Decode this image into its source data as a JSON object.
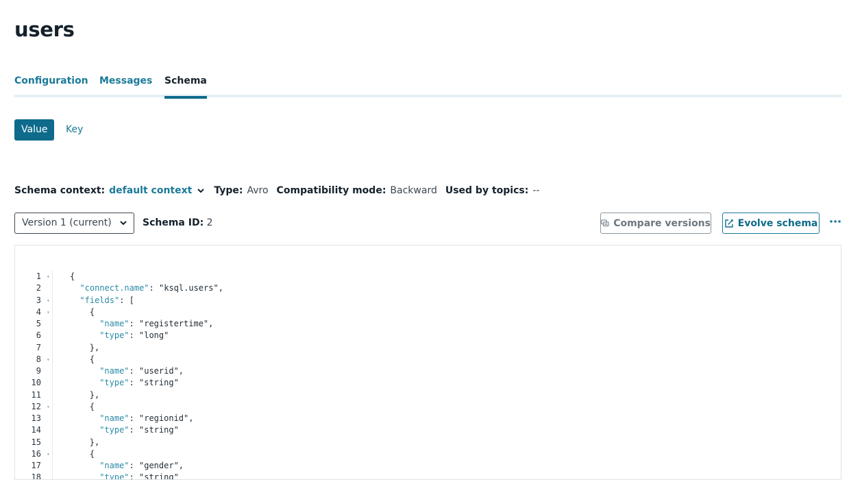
{
  "page": {
    "title": "users"
  },
  "tabs": [
    {
      "label": "Configuration"
    },
    {
      "label": "Messages"
    },
    {
      "label": "Schema"
    }
  ],
  "segment": {
    "value_label": "Value",
    "key_label": "Key"
  },
  "meta": {
    "context_label": "Schema context:",
    "context_value": "default context",
    "type_label": "Type:",
    "type_value": "Avro",
    "compat_label": "Compatibility mode:",
    "compat_value": "Backward",
    "topics_label": "Used by topics:",
    "topics_value": "--"
  },
  "version": {
    "selected": "Version 1 (current)"
  },
  "schema_id": {
    "label": "Schema ID:",
    "value": "2"
  },
  "buttons": {
    "compare": "Compare versions",
    "evolve": "Evolve schema"
  },
  "colors": {
    "accent": "#0e6b8c",
    "link": "#1b7a99"
  },
  "icons": {
    "chevron": "chevron-down-icon",
    "compare": "compare-icon",
    "edit": "edit-icon",
    "more": "more-horizontal-icon"
  },
  "code": {
    "lines": [
      {
        "n": "1",
        "fold": true,
        "indent": 0,
        "parts": [
          {
            "t": "p",
            "v": "{"
          }
        ]
      },
      {
        "n": "2",
        "fold": false,
        "indent": 1,
        "parts": [
          {
            "t": "k",
            "v": "\"connect.name\""
          },
          {
            "t": "p",
            "v": ": "
          },
          {
            "t": "s",
            "v": "\"ksql.users\""
          },
          {
            "t": "p",
            "v": ","
          }
        ]
      },
      {
        "n": "3",
        "fold": true,
        "indent": 1,
        "parts": [
          {
            "t": "k",
            "v": "\"fields\""
          },
          {
            "t": "p",
            "v": ": ["
          }
        ]
      },
      {
        "n": "4",
        "fold": true,
        "indent": 2,
        "parts": [
          {
            "t": "p",
            "v": "{"
          }
        ]
      },
      {
        "n": "5",
        "fold": false,
        "indent": 3,
        "parts": [
          {
            "t": "k",
            "v": "\"name\""
          },
          {
            "t": "p",
            "v": ": "
          },
          {
            "t": "s",
            "v": "\"registertime\""
          },
          {
            "t": "p",
            "v": ","
          }
        ]
      },
      {
        "n": "6",
        "fold": false,
        "indent": 3,
        "parts": [
          {
            "t": "k",
            "v": "\"type\""
          },
          {
            "t": "p",
            "v": ": "
          },
          {
            "t": "s",
            "v": "\"long\""
          }
        ]
      },
      {
        "n": "7",
        "fold": false,
        "indent": 2,
        "parts": [
          {
            "t": "p",
            "v": "},"
          }
        ]
      },
      {
        "n": "8",
        "fold": true,
        "indent": 2,
        "parts": [
          {
            "t": "p",
            "v": "{"
          }
        ]
      },
      {
        "n": "9",
        "fold": false,
        "indent": 3,
        "parts": [
          {
            "t": "k",
            "v": "\"name\""
          },
          {
            "t": "p",
            "v": ": "
          },
          {
            "t": "s",
            "v": "\"userid\""
          },
          {
            "t": "p",
            "v": ","
          }
        ]
      },
      {
        "n": "10",
        "fold": false,
        "indent": 3,
        "parts": [
          {
            "t": "k",
            "v": "\"type\""
          },
          {
            "t": "p",
            "v": ": "
          },
          {
            "t": "s",
            "v": "\"string\""
          }
        ]
      },
      {
        "n": "11",
        "fold": false,
        "indent": 2,
        "parts": [
          {
            "t": "p",
            "v": "},"
          }
        ]
      },
      {
        "n": "12",
        "fold": true,
        "indent": 2,
        "parts": [
          {
            "t": "p",
            "v": "{"
          }
        ]
      },
      {
        "n": "13",
        "fold": false,
        "indent": 3,
        "parts": [
          {
            "t": "k",
            "v": "\"name\""
          },
          {
            "t": "p",
            "v": ": "
          },
          {
            "t": "s",
            "v": "\"regionid\""
          },
          {
            "t": "p",
            "v": ","
          }
        ]
      },
      {
        "n": "14",
        "fold": false,
        "indent": 3,
        "parts": [
          {
            "t": "k",
            "v": "\"type\""
          },
          {
            "t": "p",
            "v": ": "
          },
          {
            "t": "s",
            "v": "\"string\""
          }
        ]
      },
      {
        "n": "15",
        "fold": false,
        "indent": 2,
        "parts": [
          {
            "t": "p",
            "v": "},"
          }
        ]
      },
      {
        "n": "16",
        "fold": true,
        "indent": 2,
        "parts": [
          {
            "t": "p",
            "v": "{"
          }
        ]
      },
      {
        "n": "17",
        "fold": false,
        "indent": 3,
        "parts": [
          {
            "t": "k",
            "v": "\"name\""
          },
          {
            "t": "p",
            "v": ": "
          },
          {
            "t": "s",
            "v": "\"gender\""
          },
          {
            "t": "p",
            "v": ","
          }
        ]
      },
      {
        "n": "18",
        "fold": false,
        "indent": 3,
        "parts": [
          {
            "t": "k",
            "v": "\"type\""
          },
          {
            "t": "p",
            "v": ": "
          },
          {
            "t": "s",
            "v": "\"string\""
          }
        ]
      }
    ]
  }
}
